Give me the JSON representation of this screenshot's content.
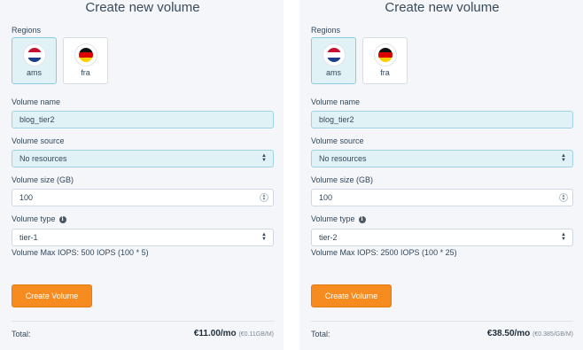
{
  "panels": [
    {
      "title": "Create new volume",
      "regions_label": "Regions",
      "regions": [
        {
          "code": "ams",
          "flag": [
            "#c8102e",
            "#ffffff",
            "#1d3e8a"
          ],
          "selected": true
        },
        {
          "code": "fra",
          "flag": [
            "#111111",
            "#dd0000",
            "#ffce00"
          ],
          "selected": false
        }
      ],
      "volume_name_label": "Volume name",
      "volume_name_value": "blog_tier2",
      "volume_source_label": "Volume source",
      "volume_source_value": "No resources",
      "volume_size_label": "Volume size (GB)",
      "volume_size_value": "100",
      "volume_type_label": "Volume type",
      "volume_type_value": "tier-1",
      "max_iops": "Volume Max IOPS: 500 IOPS (100 * 5)",
      "create_button": "Create Volume",
      "total_label": "Total:",
      "total_price": "€11.00/mo",
      "total_rate": "(€0.11GB/M)"
    },
    {
      "title": "Create new volume",
      "regions_label": "Regions",
      "regions": [
        {
          "code": "ams",
          "flag": [
            "#c8102e",
            "#ffffff",
            "#1d3e8a"
          ],
          "selected": true
        },
        {
          "code": "fra",
          "flag": [
            "#111111",
            "#dd0000",
            "#ffce00"
          ],
          "selected": false
        }
      ],
      "volume_name_label": "Volume name",
      "volume_name_value": "blog_tier2",
      "volume_source_label": "Volume source",
      "volume_source_value": "No resources",
      "volume_size_label": "Volume size (GB)",
      "volume_size_value": "100",
      "volume_type_label": "Volume type",
      "volume_type_value": "tier-2",
      "max_iops": "Volume Max IOPS: 2500 IOPS (100 * 25)",
      "create_button": "Create Volume",
      "total_label": "Total:",
      "total_price": "€38.50/mo",
      "total_rate": "(€0.385/GB/M)"
    }
  ],
  "colors": {
    "accent": "#f68b1f",
    "selected_bg": "#e1f2f7",
    "panel_bg": "#f4f6f9"
  },
  "icons": {
    "info": "info-icon",
    "select": "select-arrows-icon",
    "stepper": "stepper-icon"
  }
}
